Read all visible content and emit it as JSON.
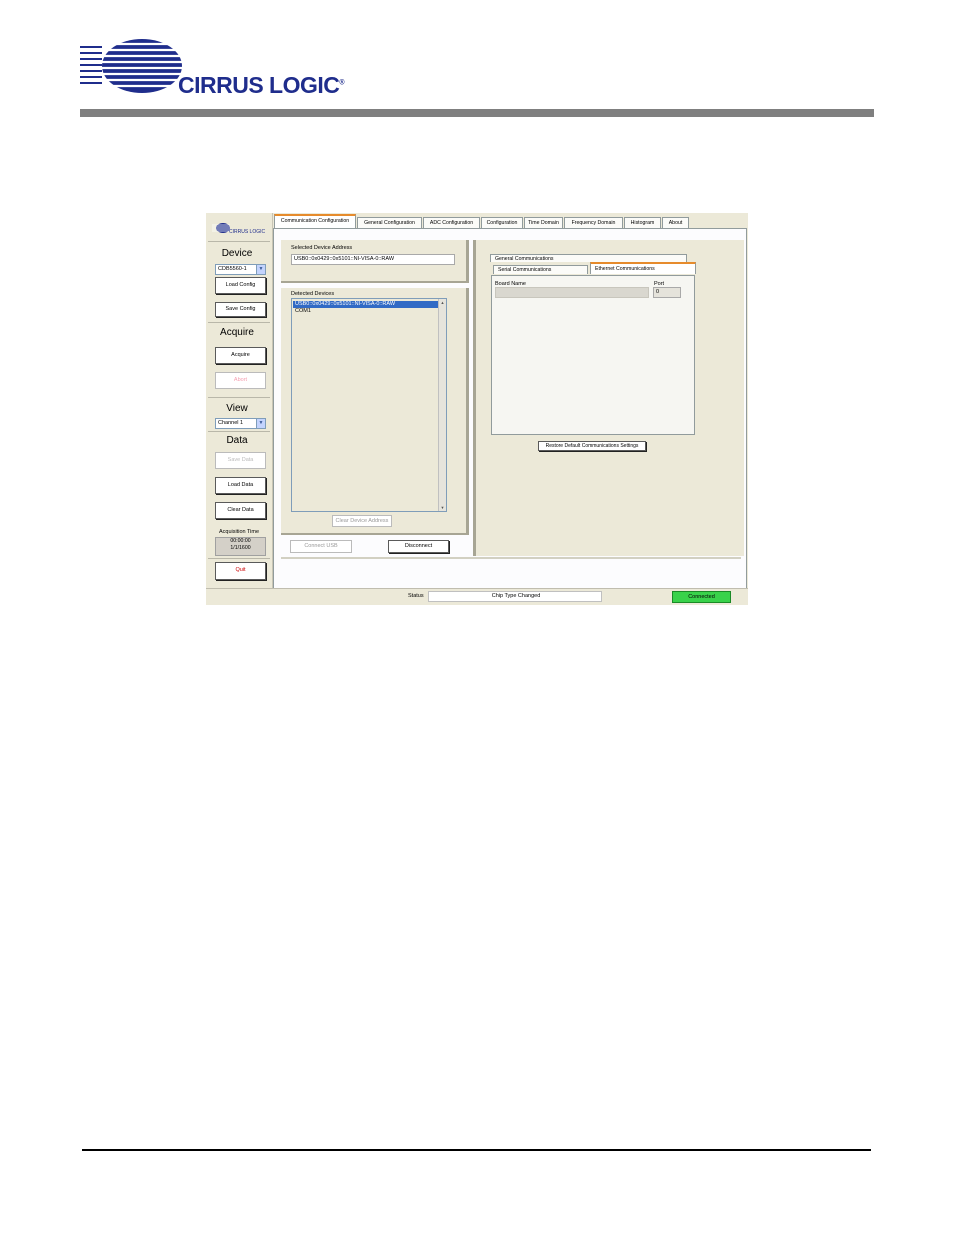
{
  "header": {
    "brand_text": "CIRRUS LOGIC",
    "brand_color": "#1f2d8c",
    "bar_color": "#7f7f7f"
  },
  "app": {
    "side_logo": "CIRRUS LOGIC",
    "device": {
      "title": "Device",
      "selected": "CDB5560-1",
      "load_config": "Load Config",
      "save_config": "Save Config"
    },
    "acquire": {
      "title": "Acquire",
      "acquire_btn": "Acquire",
      "abort_btn": "Abort"
    },
    "view": {
      "title": "View",
      "selected": "Channel 1"
    },
    "data": {
      "title": "Data",
      "save_data": "Save Data",
      "load_data": "Load Data",
      "clear_data": "Clear Data",
      "acq_time_label": "Acquisition Time",
      "acq_time_value": "00:00:00",
      "acq_date_value": "1/1/1600"
    },
    "quit": "Quit",
    "tabs": [
      {
        "label": "Communication Configuration",
        "active": true
      },
      {
        "label": "General Configuration",
        "active": false
      },
      {
        "label": "ADC Configuration",
        "active": false
      },
      {
        "label": "Configuration",
        "active": false
      },
      {
        "label": "Time Domain",
        "active": false
      },
      {
        "label": "Frequency Domain",
        "active": false
      },
      {
        "label": "Histogram",
        "active": false
      },
      {
        "label": "About",
        "active": false
      }
    ],
    "comm": {
      "selected_label": "Selected Device Address",
      "selected_value": "USB0::0x0429::0x5101::NI-VISA-0::RAW",
      "detected_label": "Detected Devices",
      "devices": [
        "USB0::0x0429::0x5101::NI-VISA-0::RAW",
        "COM1"
      ],
      "clear_address": "Clear Device Address",
      "connect_usb": "Connect USB",
      "disconnect": "Disconnect"
    },
    "subtabs": {
      "general": "General Communications",
      "serial": "Serial Communications",
      "ethernet": "Ethernet Communications"
    },
    "ethernet": {
      "board_name_label": "Board Name",
      "board_name_value": "",
      "port_label": "Port",
      "port_value": "0"
    },
    "restore_btn": "Restore Default Communications Settings",
    "status": {
      "label": "Status",
      "value": "Chip Type Changed",
      "connection": "Connected",
      "connection_color": "#39d24a"
    }
  }
}
